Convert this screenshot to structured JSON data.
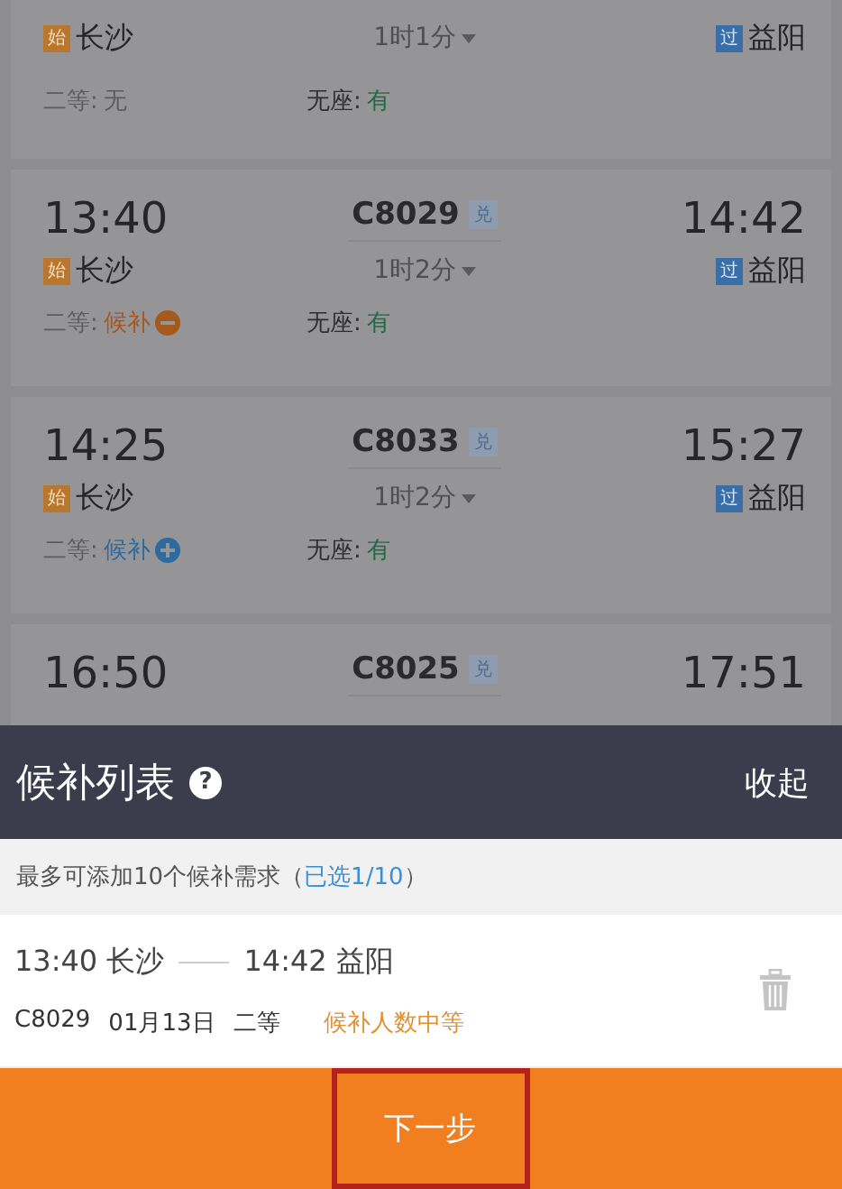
{
  "trains": [
    {
      "from_station": {
        "badge": "始",
        "name": "长沙"
      },
      "duration": "1时1分",
      "to_station": {
        "badge": "过",
        "name": "益阳"
      },
      "seats": [
        {
          "label": "二等:",
          "status": "无",
          "kind": "none"
        },
        {
          "label": "无座:",
          "status": "有",
          "kind": "available"
        }
      ]
    },
    {
      "dep_time": "13:40",
      "train_no": "C8029",
      "train_badge": "兑",
      "arr_time": "14:42",
      "from_station": {
        "badge": "始",
        "name": "长沙"
      },
      "duration": "1时2分",
      "to_station": {
        "badge": "过",
        "name": "益阳"
      },
      "seats": [
        {
          "label": "二等:",
          "status": "候补",
          "kind": "waitlist_added"
        },
        {
          "label": "无座:",
          "status": "有",
          "kind": "available"
        }
      ]
    },
    {
      "dep_time": "14:25",
      "train_no": "C8033",
      "train_badge": "兑",
      "arr_time": "15:27",
      "from_station": {
        "badge": "始",
        "name": "长沙"
      },
      "duration": "1时2分",
      "to_station": {
        "badge": "过",
        "name": "益阳"
      },
      "seats": [
        {
          "label": "二等:",
          "status": "候补",
          "kind": "waitlist"
        },
        {
          "label": "无座:",
          "status": "有",
          "kind": "available"
        }
      ]
    },
    {
      "dep_time": "16:50",
      "train_no": "C8025",
      "train_badge": "兑",
      "arr_time": "17:51"
    }
  ],
  "waitlist_panel": {
    "title": "候补列表",
    "help_icon": "?",
    "collapse": "收起",
    "notice": {
      "text": "最多可添加10个候补需求（",
      "count": "已选1/10",
      "end": "）"
    },
    "items": [
      {
        "dep_time": "13:40",
        "from": "长沙",
        "arr_time": "14:42",
        "to": "益阳",
        "train_no": "C8029",
        "date": "01月13日",
        "seat_class": "二等",
        "demand": "候补人数中等"
      }
    ]
  },
  "next_button": {
    "label": "下一步",
    "highlighted": true
  }
}
